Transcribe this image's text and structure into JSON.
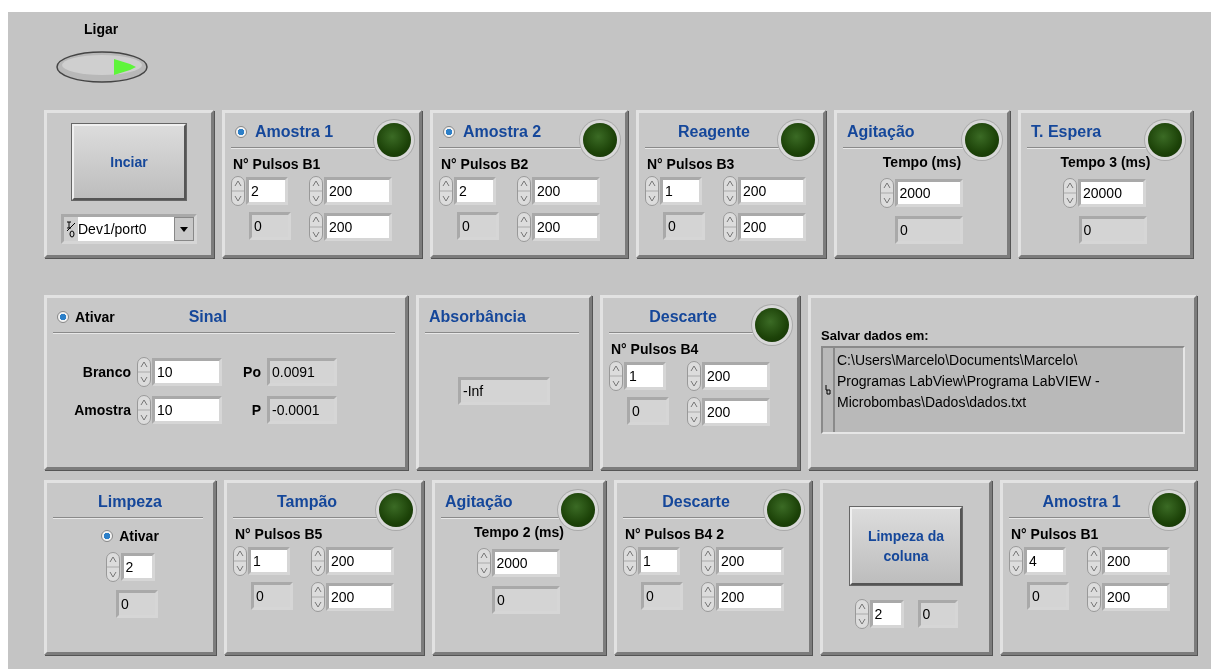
{
  "switch": {
    "label": "Ligar",
    "on": true
  },
  "rows": [
    {
      "cards": [
        {
          "kind": "start",
          "button": "Inciar",
          "channel": "Dev1/port0"
        },
        {
          "kind": "pulse",
          "title": "Amostra 1",
          "radio": {
            "selected": true
          },
          "led": {
            "on": false
          },
          "label": "N° Pulsos B1",
          "pulses": "2",
          "time_on": "200",
          "count": "0",
          "time_off": "200"
        },
        {
          "kind": "pulse",
          "title": "Amostra 2",
          "radio": {
            "selected": true
          },
          "led": {
            "on": false
          },
          "label": "N° Pulsos B2",
          "pulses": "2",
          "time_on": "200",
          "count": "0",
          "time_off": "200"
        },
        {
          "kind": "pulse",
          "title": "Reagente",
          "led": {
            "on": false
          },
          "label": "N° Pulsos B3",
          "pulses": "1",
          "time_on": "200",
          "count": "0",
          "time_off": "200"
        },
        {
          "kind": "time",
          "title": "Agitação",
          "led": {
            "on": false
          },
          "label": "Tempo (ms)",
          "value": "2000",
          "readout": "0"
        },
        {
          "kind": "time",
          "title": "T. Espera",
          "led": {
            "on": false
          },
          "label": "Tempo 3 (ms)",
          "value": "20000",
          "readout": "0"
        }
      ]
    },
    {
      "cards": [
        {
          "kind": "signal",
          "radio": {
            "label": "Ativar",
            "selected": true
          },
          "title": "Sinal",
          "rows": [
            {
              "label": "Branco",
              "value": "10",
              "out_label": "Po",
              "readout": "0.0091"
            },
            {
              "label": "Amostra",
              "value": "10",
              "out_label": "P",
              "readout": "-0.0001"
            }
          ]
        },
        {
          "kind": "readout",
          "title": "Absorbância",
          "readout": "-Inf"
        },
        {
          "kind": "pulse",
          "title": "Descarte",
          "led": {
            "on": false
          },
          "label": "N° Pulsos B4",
          "pulses": "1",
          "time_on": "200",
          "count": "0",
          "time_off": "200"
        },
        {
          "kind": "path",
          "label": "Salvar dados em:",
          "lines": [
            "C:\\Users\\Marcelo\\Documents\\Marcelo\\",
            "Programas LabView\\Programa LabVIEW -",
            "Microbombas\\Dados\\dados.txt"
          ]
        }
      ]
    },
    {
      "cards": [
        {
          "kind": "cleaning",
          "title": "Limpeza",
          "radio": {
            "label": "Ativar",
            "selected": true
          },
          "value": "2",
          "readout": "0"
        },
        {
          "kind": "pulse",
          "title": "Tampão",
          "led": {
            "on": false
          },
          "label": "N° Pulsos B5",
          "pulses": "1",
          "time_on": "200",
          "count": "0",
          "time_off": "200"
        },
        {
          "kind": "time",
          "title": "Agitação",
          "led": {
            "on": false
          },
          "label": "Tempo 2 (ms)",
          "value": "2000",
          "readout": "0"
        },
        {
          "kind": "pulse",
          "title": "Descarte",
          "led": {
            "on": false
          },
          "label": "N° Pulsos B4 2",
          "pulses": "1",
          "time_on": "200",
          "count": "0",
          "time_off": "200"
        },
        {
          "kind": "button-counter",
          "button": "Limpeza da coluna",
          "value": "2",
          "readout": "0"
        },
        {
          "kind": "pulse",
          "title": "Amostra 1",
          "led": {
            "on": false
          },
          "label": "N° Pulsos B1",
          "pulses": "4",
          "time_on": "200",
          "count": "0",
          "time_off": "200"
        }
      ]
    }
  ]
}
